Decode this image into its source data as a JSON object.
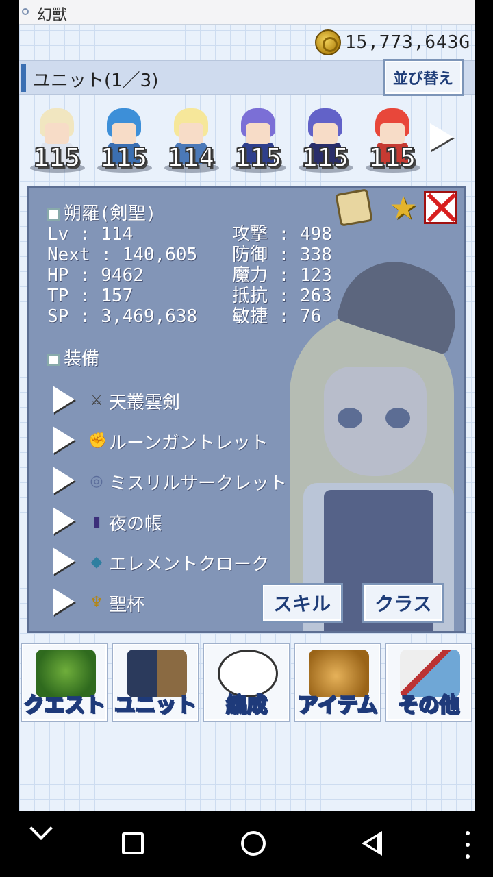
{
  "app": {
    "title": "幻獸"
  },
  "gold": {
    "amount": "15,773,643G",
    "icon": "coin-icon"
  },
  "unit_header": {
    "label": "ユニット(1／3)",
    "sort_label": "並び替え"
  },
  "roster": [
    {
      "level": "115",
      "hair": "#f1e6c0",
      "outfit": "#dfe4ee"
    },
    {
      "level": "115",
      "hair": "#3d8fd8",
      "outfit": "#3b6fb2"
    },
    {
      "level": "114",
      "hair": "#f6e79a",
      "outfit": "#4b79b8"
    },
    {
      "level": "115",
      "hair": "#7b6fd6",
      "outfit": "#2f3f8c"
    },
    {
      "level": "115",
      "hair": "#6262c8",
      "outfit": "#2a2e6a"
    },
    {
      "level": "115",
      "hair": "#e8473a",
      "outfit": "#c63a32"
    }
  ],
  "character": {
    "name": "朔羅(剣聖)",
    "stats_left": [
      {
        "label": "Lv",
        "value": "114"
      },
      {
        "label": "Next",
        "value": "140,605"
      },
      {
        "label": "HP",
        "value": "9462"
      },
      {
        "label": "TP",
        "value": "157"
      },
      {
        "label": "SP",
        "value": "3,469,638"
      }
    ],
    "stats_right": [
      {
        "label": "攻撃",
        "value": "498"
      },
      {
        "label": "防御",
        "value": "338"
      },
      {
        "label": "魔力",
        "value": "123"
      },
      {
        "label": "抵抗",
        "value": "263"
      },
      {
        "label": "敏捷",
        "value": "76"
      }
    ]
  },
  "equipment": {
    "title": "装備",
    "items": [
      {
        "name": "天叢雲剣",
        "icon": "sword-icon"
      },
      {
        "name": "ルーンガントレット",
        "icon": "gauntlet-icon"
      },
      {
        "name": "ミスリルサークレット",
        "icon": "circlet-icon"
      },
      {
        "name": "夜の帳",
        "icon": "cloak-icon"
      },
      {
        "name": "エレメントクローク",
        "icon": "cape-icon"
      },
      {
        "name": "聖杯",
        "icon": "chalice-icon"
      }
    ]
  },
  "panel_buttons": {
    "skill": "スキル",
    "class": "クラス"
  },
  "menu": [
    {
      "label": "クエスト",
      "icon": "tree-icon"
    },
    {
      "label": "ユニット",
      "icon": "party-icon"
    },
    {
      "label": "編成",
      "icon": "face-icon"
    },
    {
      "label": "アイテム",
      "icon": "bag-icon"
    },
    {
      "label": "その他",
      "icon": "quill-icon"
    }
  ]
}
